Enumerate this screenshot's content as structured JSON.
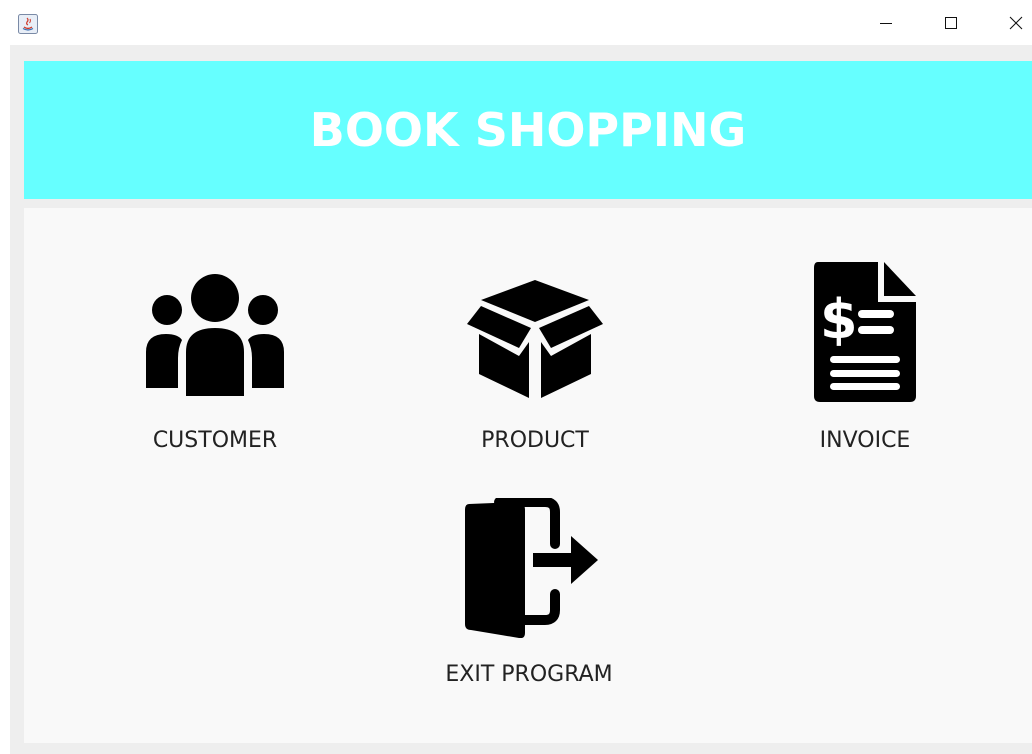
{
  "window": {
    "controls": {
      "minimize": "minimize-icon",
      "maximize": "maximize-icon",
      "close": "close-icon"
    }
  },
  "header": {
    "title": "BOOK SHOPPING",
    "background": "#66ffff",
    "text_color": "#ffffff"
  },
  "menu": {
    "customer": {
      "label": "CUSTOMER",
      "icon": "users-group-icon"
    },
    "product": {
      "label": "PRODUCT",
      "icon": "box-icon"
    },
    "invoice": {
      "label": "INVOICE",
      "icon": "invoice-dollar-icon"
    },
    "exit": {
      "label": "EXIT PROGRAM",
      "icon": "exit-door-icon"
    }
  }
}
